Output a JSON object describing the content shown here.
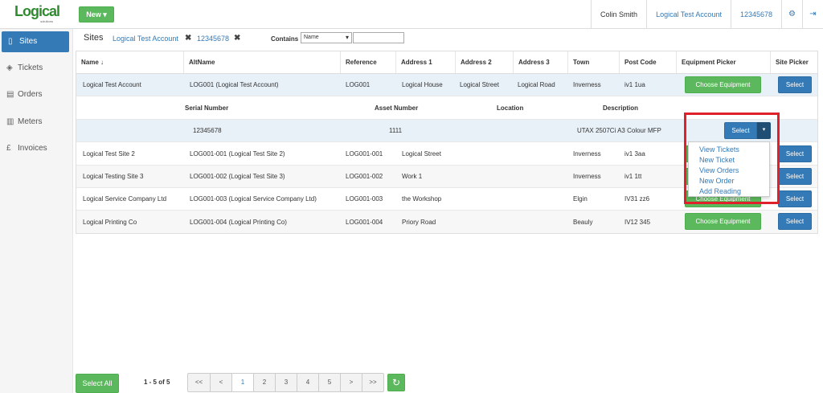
{
  "logo": {
    "text": "Logical",
    "sub": "solutions"
  },
  "topbar": {
    "new_label": "New",
    "new_caret": "▾",
    "user_name": "Colin Smith",
    "account_name": "Logical Test Account",
    "account_number": "12345678",
    "settings_icon": "⚙",
    "logout_icon": "⇥"
  },
  "sidebar": {
    "items": [
      {
        "label": "Sites",
        "icon": "▯",
        "active": true
      },
      {
        "label": "Tickets",
        "icon": "◈",
        "active": false
      },
      {
        "label": "Orders",
        "icon": "▤",
        "active": false
      },
      {
        "label": "Meters",
        "icon": "▥",
        "active": false
      },
      {
        "label": "Invoices",
        "icon": "£",
        "active": false
      }
    ]
  },
  "filter": {
    "title": "Sites",
    "chip1": "Logical Test Account",
    "chip2": "12345678",
    "remove_icon": "✖",
    "contains_label": "Contains",
    "field_value": "Name",
    "search_value": ""
  },
  "table": {
    "headers": {
      "name": "Name ↓",
      "altname": "AltName",
      "reference": "Reference",
      "address1": "Address 1",
      "address2": "Address 2",
      "address3": "Address 3",
      "town": "Town",
      "postcode": "Post Code",
      "equipment": "Equipment Picker",
      "site": "Site Picker"
    },
    "rows": [
      {
        "name": "Logical Test Account",
        "altname": "LOG001 (Logical Test Account)",
        "reference": "LOG001",
        "address1": "Logical House",
        "address2": "Logical Street",
        "address3": "Logical Road",
        "town": "Inverness",
        "postcode": "iv1 1ua"
      },
      {
        "name": "Logical Test Site 2",
        "altname": "LOG001-001 (Logical Test Site 2)",
        "reference": "LOG001-001",
        "address1": "Logical Street",
        "address2": "",
        "address3": "",
        "town": "Inverness",
        "postcode": "iv1 3aa"
      },
      {
        "name": "Logical Testing Site 3",
        "altname": "LOG001-002 (Logical Test Site 3)",
        "reference": "LOG001-002",
        "address1": "Work 1",
        "address2": "",
        "address3": "",
        "town": "Inverness",
        "postcode": "iv1 1tt"
      },
      {
        "name": "Logical Service Company Ltd",
        "altname": "LOG001-003 (Logical Service Company Ltd)",
        "reference": "LOG001-003",
        "address1": "the Workshop",
        "address2": "",
        "address3": "",
        "town": "Elgin",
        "postcode": "IV31 zz6"
      },
      {
        "name": "Logical Printing Co",
        "altname": "LOG001-004 (Logical Printing Co)",
        "reference": "LOG001-004",
        "address1": "Priory Road",
        "address2": "",
        "address3": "",
        "town": "Beauly",
        "postcode": "IV12 345"
      }
    ],
    "choose_label": "Choose Equipment",
    "select_label": "Select",
    "sub_headers": {
      "serial": "Serial Number",
      "asset": "Asset Number",
      "location": "Location",
      "description": "Description"
    },
    "equipment": {
      "serial": "12345678",
      "asset": "1111",
      "location": "",
      "description": "UTAX 2507Ci A3 Colour MFP"
    }
  },
  "dropdown": {
    "select_label": "Select",
    "caret": "▾",
    "items": [
      "View Tickets",
      "New Ticket",
      "View Orders",
      "New Order",
      "Add Reading"
    ]
  },
  "footer": {
    "select_all_label": "Select All",
    "range": "1 - 5 of 5",
    "pages": [
      "<<",
      "<",
      "1",
      "2",
      "3",
      "4",
      "5",
      ">",
      ">>"
    ],
    "current_page": "1",
    "refresh_icon": "↻"
  },
  "colors": {
    "primary": "#337ab7",
    "success": "#5cb85c",
    "highlight_row": "#e8f1f8",
    "annotation": "#e0202a"
  }
}
